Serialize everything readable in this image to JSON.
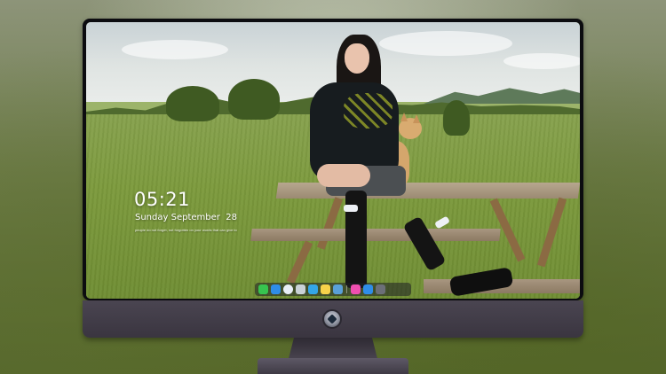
{
  "lockscreen": {
    "time": "05:21",
    "date": "Sunday September  28",
    "quote": "people do not forget, not forgotten on your words that can give to"
  },
  "dock": {
    "apps": [
      {
        "name": "messages-icon",
        "color": "#37c44f"
      },
      {
        "name": "finder-icon",
        "color": "#2f8de8"
      },
      {
        "name": "safari-icon",
        "color": "#e8eef6"
      },
      {
        "name": "photos-icon",
        "color": "#c9d2d6"
      },
      {
        "name": "claquette-icon",
        "color": "#34a6e8"
      },
      {
        "name": "notes-icon",
        "color": "#f6d24a"
      },
      {
        "name": "preview-icon",
        "color": "#5aa0d8"
      },
      {
        "name": "itunes-icon",
        "color": "#ef4fb0"
      },
      {
        "name": "app-store-icon",
        "color": "#2f8de8"
      },
      {
        "name": "camera-icon",
        "color": "#6c6f78"
      }
    ]
  },
  "colors": {
    "bezel": "#0c0c10",
    "chin": "#4a4551",
    "background": "#6f7d4c"
  }
}
